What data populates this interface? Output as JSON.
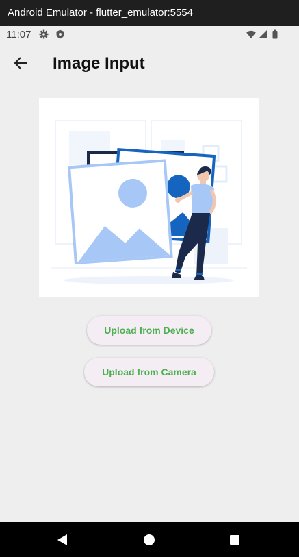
{
  "window": {
    "title": "Android Emulator - flutter_emulator:5554"
  },
  "status_bar": {
    "time": "11:07",
    "icons": [
      "gear-icon",
      "shield-icon",
      "wifi-icon",
      "signal-icon",
      "battery-icon"
    ]
  },
  "app_bar": {
    "back_icon": "arrow-left-icon",
    "title": "Image Input"
  },
  "illustration": {
    "description_icon": "image-upload-illustration"
  },
  "actions": {
    "upload_device_label": "Upload from Device",
    "upload_camera_label": "Upload from Camera"
  },
  "nav_bar": {
    "icons": [
      "back-triangle-icon",
      "home-circle-icon",
      "recents-square-icon"
    ]
  },
  "colors": {
    "background": "#eeeeee",
    "accent_text": "#4caf50",
    "button_bg": "#f4eef4",
    "illustration_blue": "#1565c0",
    "illustration_light_blue": "#a7c7f7",
    "figure_navy": "#1b2a4a"
  }
}
